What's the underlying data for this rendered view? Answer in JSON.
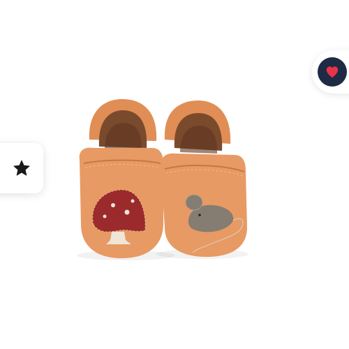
{
  "product": {
    "image": {
      "subject": "baby-leather-moccasins",
      "colors": {
        "leather": "#e79a63",
        "leather_dark": "#c9773f",
        "lining": "#7a4a2d",
        "mushroom_cap": "#9b2a2c",
        "mushroom_stem": "#efe6d8",
        "mouse": "#857c72"
      }
    }
  },
  "actions": {
    "favorite": {
      "icon": "heart-icon",
      "active_color": "#e8334a",
      "bg_color": "#1f2a44"
    },
    "rate": {
      "icon": "star-icon",
      "color": "#1a1a1a"
    }
  }
}
